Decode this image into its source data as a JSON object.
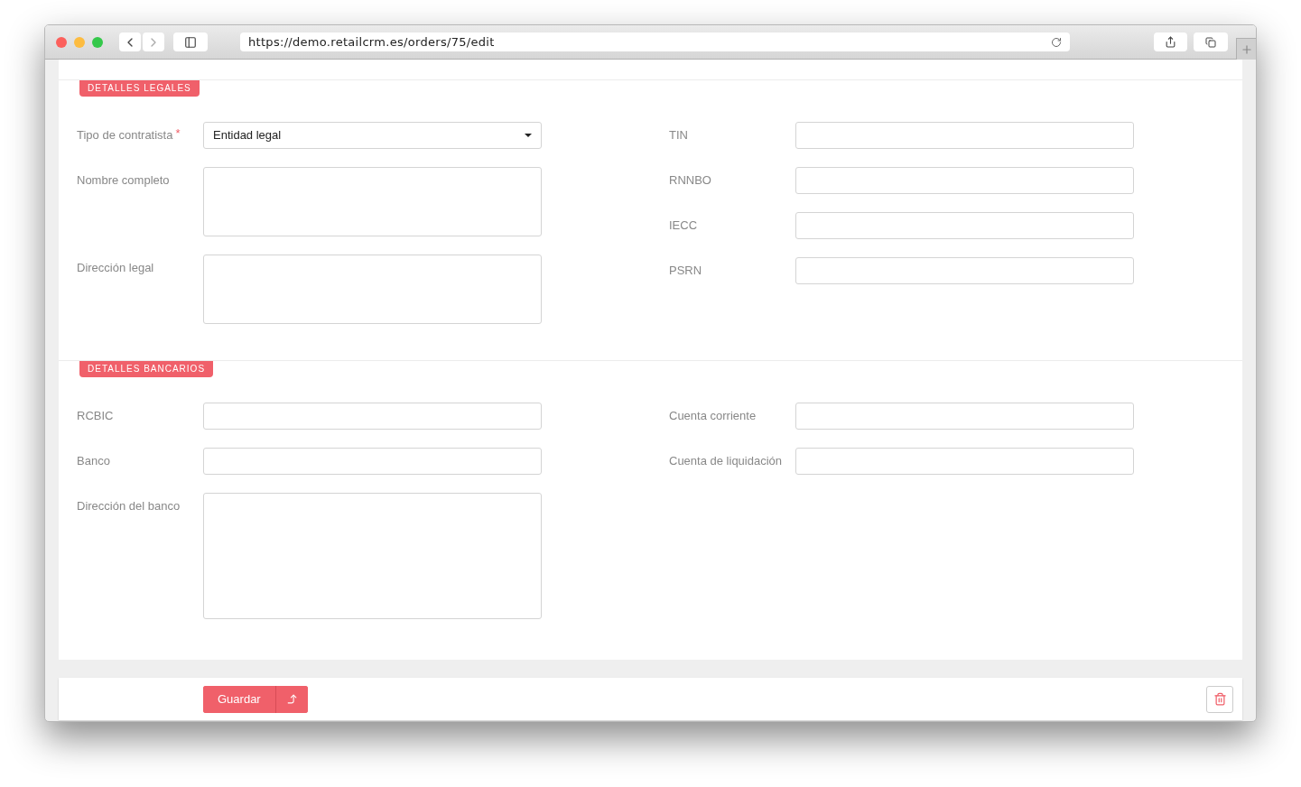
{
  "browser": {
    "url": "https://demo.retailcrm.es/orders/75/edit"
  },
  "sections": [
    {
      "title": "DETALLES LEGALES",
      "left": [
        {
          "label": "Tipo de contratista",
          "required_mark": "*",
          "kind": "select",
          "value": "Entidad legal"
        },
        {
          "label": "Nombre completo",
          "kind": "textarea"
        },
        {
          "label": "Dirección legal",
          "kind": "textarea"
        }
      ],
      "right": [
        {
          "label": "TIN",
          "kind": "text"
        },
        {
          "label": "RNNBO",
          "kind": "text"
        },
        {
          "label": "IECC",
          "kind": "text"
        },
        {
          "label": "PSRN",
          "kind": "text"
        }
      ]
    },
    {
      "title": "DETALLES BANCARIOS",
      "left": [
        {
          "label": "RCBIC",
          "kind": "text"
        },
        {
          "label": "Banco",
          "kind": "text"
        },
        {
          "label": "Dirección del banco",
          "kind": "bigtextarea"
        }
      ],
      "right": [
        {
          "label": "Cuenta corriente",
          "kind": "text"
        },
        {
          "label": "Cuenta de liquidación",
          "kind": "text"
        }
      ]
    }
  ],
  "footer": {
    "save_label": "Guardar"
  }
}
